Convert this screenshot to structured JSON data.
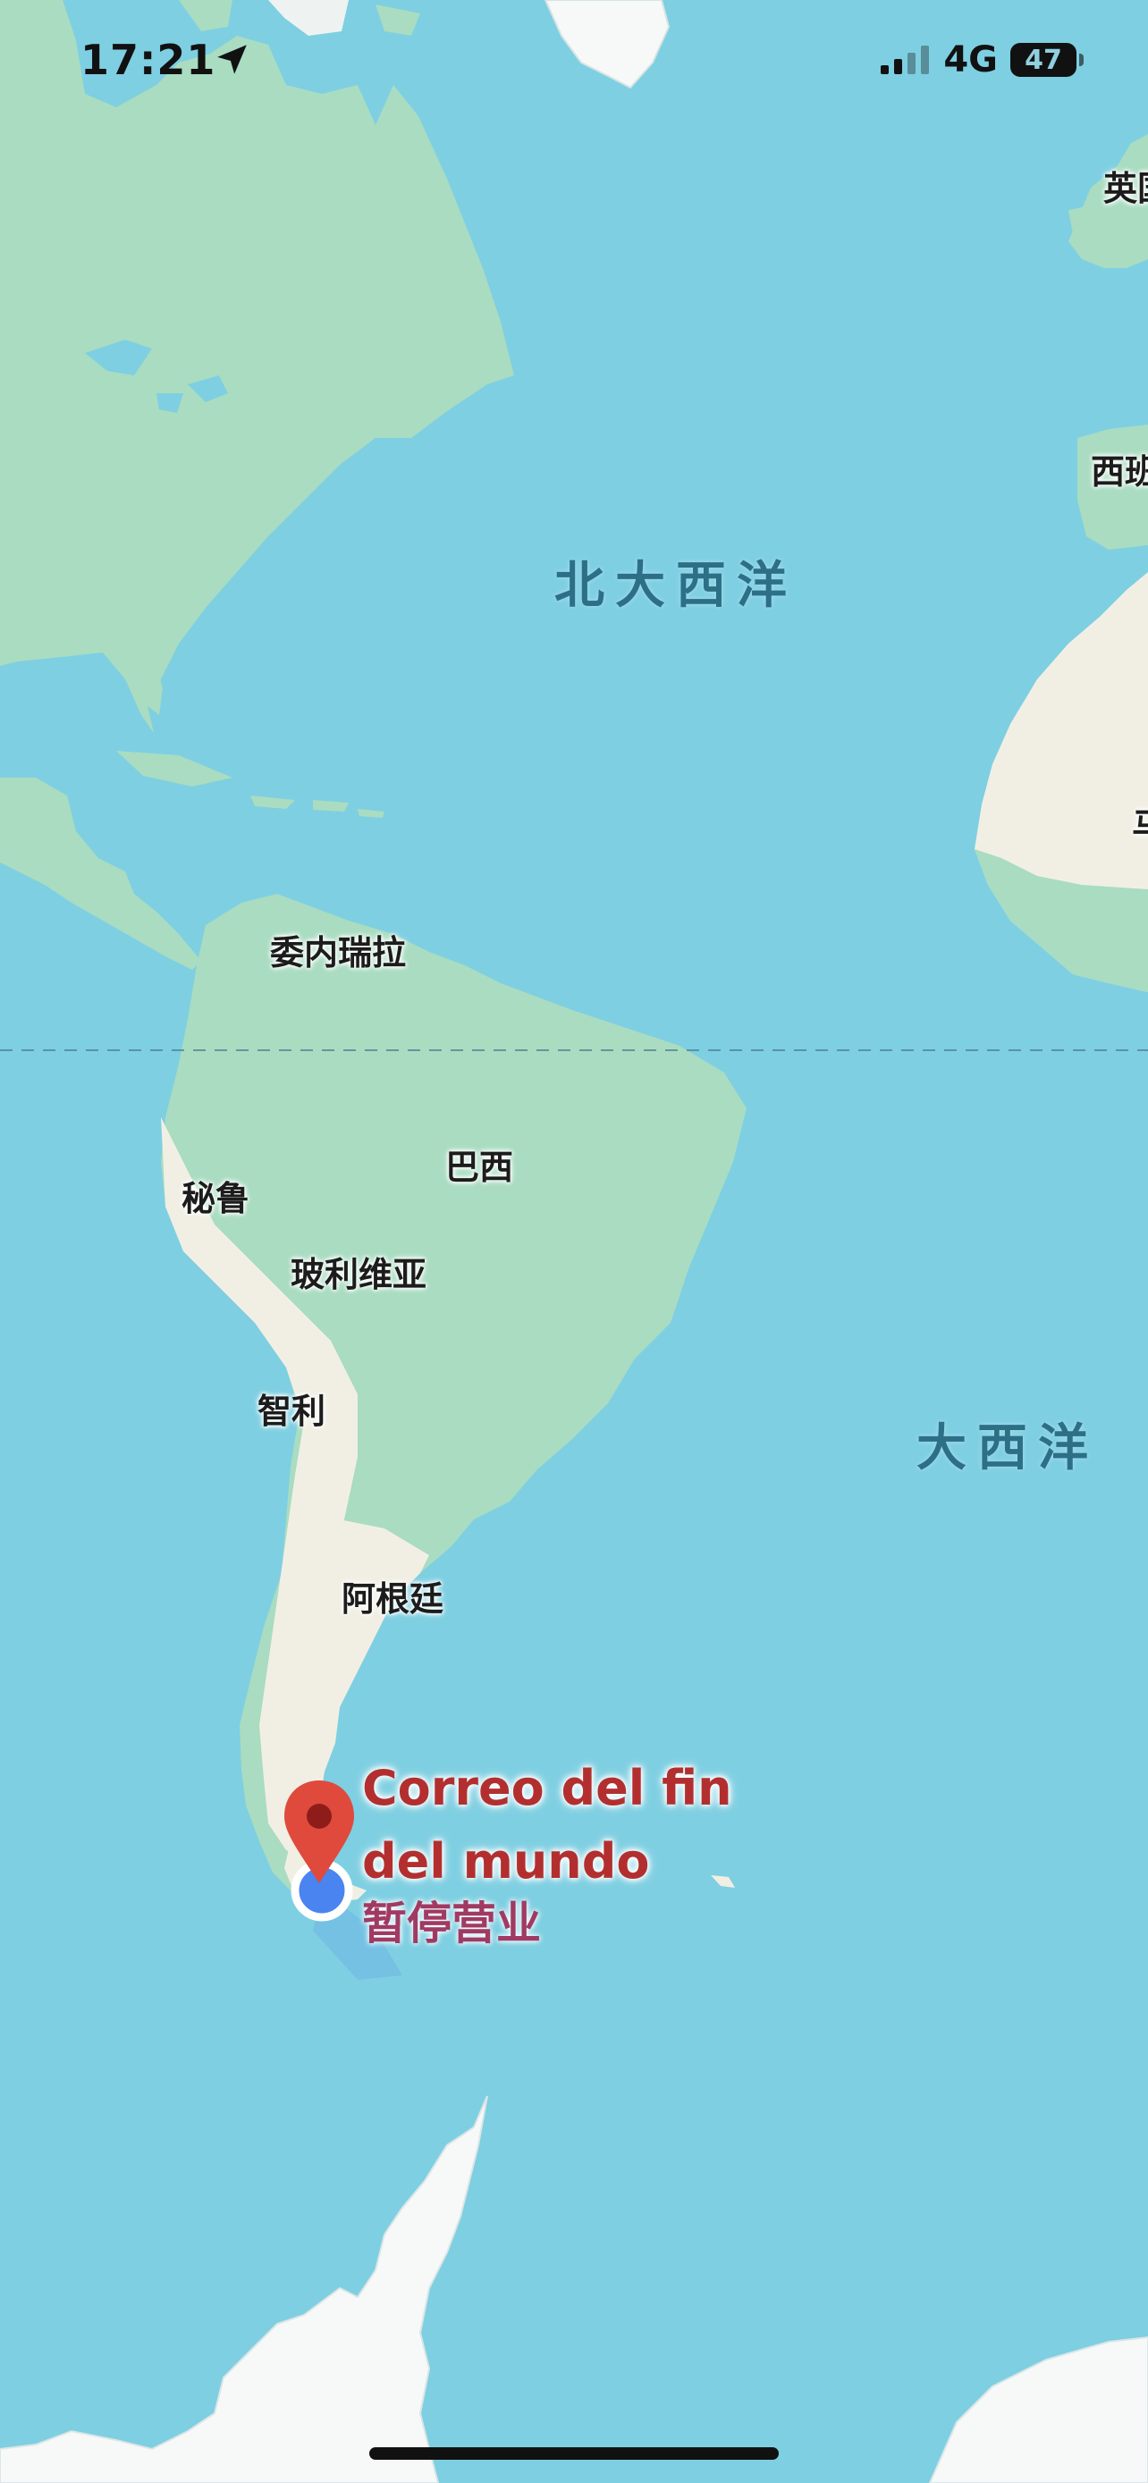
{
  "status_bar": {
    "time": "17:21",
    "network": "4G",
    "battery": "47"
  },
  "map": {
    "ocean_labels": {
      "north_atlantic": "北大西洋",
      "atlantic": "大西洋"
    },
    "country_labels": {
      "venezuela": "委内瑞拉",
      "brazil": "巴西",
      "peru": "秘鲁",
      "bolivia": "玻利维亚",
      "chile": "智利",
      "argentina": "阿根廷",
      "uk_partial": "英国",
      "spain_partial": "西班",
      "africa_partial": "马"
    }
  },
  "place": {
    "name": "Correo del fin del mundo",
    "status": "暂停营业"
  },
  "colors": {
    "ocean": "#7ecfe2",
    "land_green": "#a9dcc1",
    "land_desert": "#f1efe4",
    "ice": "#f7f9f9",
    "pin": "#df4a3d",
    "location_dot": "#4a84f0"
  }
}
